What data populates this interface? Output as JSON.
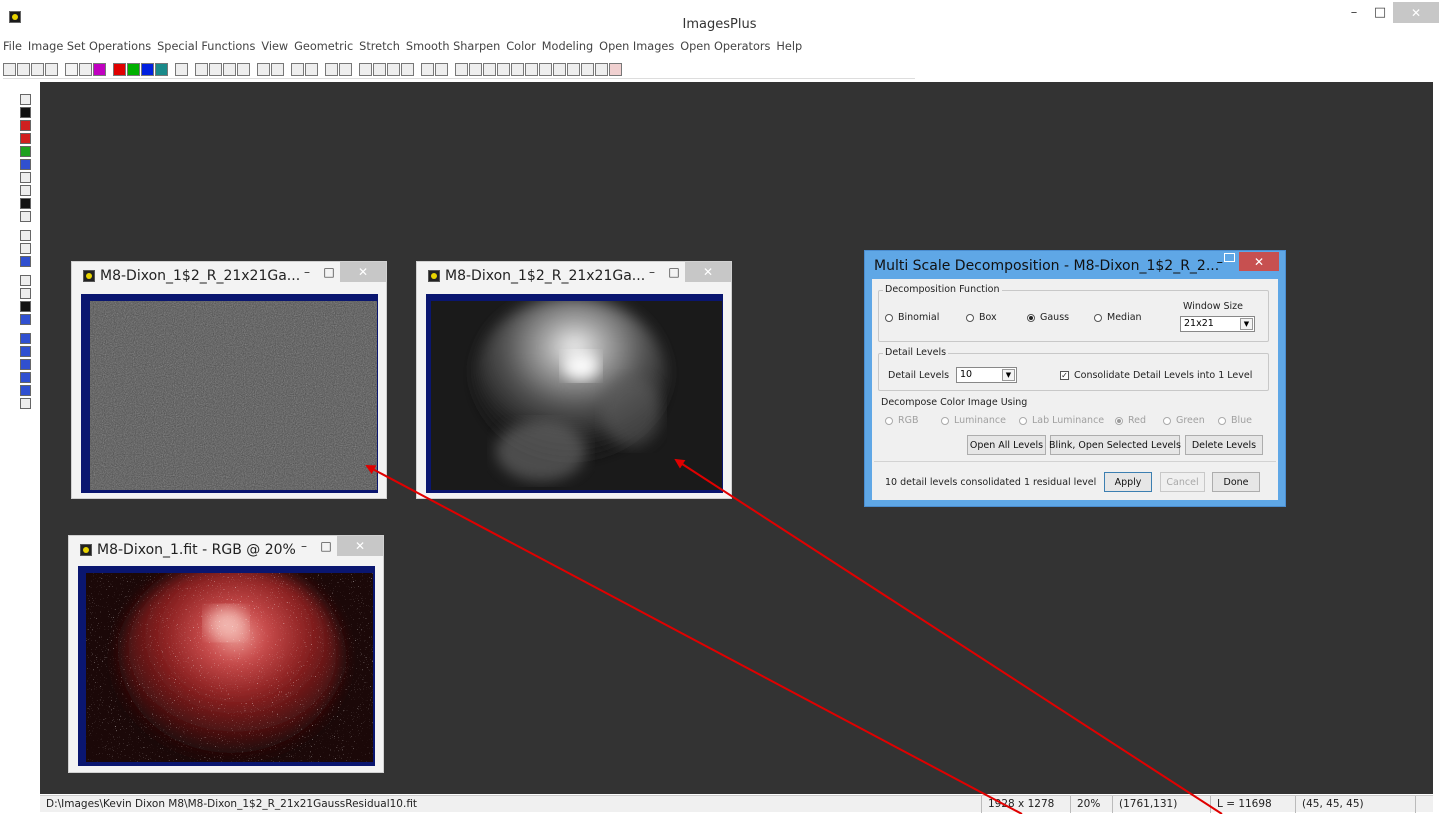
{
  "window": {
    "title": "ImagesPlus",
    "minimize": "–",
    "maximize": "□",
    "close": "✕"
  },
  "menu": [
    "File",
    "Image Set Operations",
    "Special Functions",
    "View",
    "Geometric",
    "Stretch",
    "Smooth Sharpen",
    "Color",
    "Modeling",
    "Open Images",
    "Open Operators",
    "Help"
  ],
  "toolbar_icons": [
    "new-icon",
    "open-icon",
    "save-icon",
    "cross-icon",
    "red-cross-icon",
    "calc-icon",
    "rgb-icon",
    "red-icon",
    "green-icon",
    "blue-icon",
    "teal-icon",
    "arrow-left-icon",
    "arrow-right-icon",
    "arrow-left-red-icon",
    "arrow-right-red-icon",
    "align-icon",
    "align2-icon",
    "dots-icon",
    "dots2-icon",
    "triangle-icon",
    "l-icon",
    "plus-icon",
    "crosshair-icon",
    "grid-icon",
    "grid2-icon",
    "pencil-icon",
    "square-icon",
    "zoom-in-icon",
    "zoom-icon",
    "zoom-fit-icon",
    "zoom-out-icon",
    "plus-box-icon",
    "minus-box-icon",
    "frame1-icon",
    "frame2-icon",
    "frame3-icon",
    "frame4-icon",
    "frame5-icon",
    "frame6-icon",
    "grid-red-icon"
  ],
  "image_windows": [
    {
      "title": "M8-Dixon_1$2_R_21x21Ga...",
      "kind": "residual"
    },
    {
      "title": "M8-Dixon_1$2_R_21x21Ga...",
      "kind": "gauss"
    },
    {
      "title": "M8-Dixon_1.fit - RGB @ 20%",
      "kind": "rgb"
    }
  ],
  "dialog": {
    "title": "Multi Scale Decomposition - M8-Dixon_1$2_R_2...",
    "decomposition": {
      "legend": "Decomposition Function",
      "options": [
        "Binomial",
        "Box",
        "Gauss",
        "Median"
      ],
      "selected": "Gauss",
      "window_size_label": "Window Size",
      "window_size": "21x21"
    },
    "detail": {
      "legend": "Detail Levels",
      "label": "Detail Levels",
      "value": "10",
      "consolidate_label": "Consolidate Detail Levels into 1 Level",
      "consolidate_checked": true
    },
    "color": {
      "legend": "Decompose Color Image Using",
      "options": [
        "RGB",
        "Luminance",
        "Lab Luminance",
        "Red",
        "Green",
        "Blue"
      ],
      "selected": "Red"
    },
    "buttons": {
      "open_all": "Open All Levels",
      "blink": "Blink, Open Selected Levels",
      "delete": "Delete Levels",
      "apply": "Apply",
      "cancel": "Cancel",
      "done": "Done"
    },
    "status": "10 detail levels consolidated  1 residual level"
  },
  "status": {
    "path": "D:\\Images\\Kevin Dixon M8\\M8-Dixon_1$2_R_21x21GaussResidual10.fit",
    "size": "1928 x 1278",
    "zoom": "20%",
    "coords": "(1761,131)",
    "luminance": "L = 11698",
    "rgb": "(45, 45, 45)"
  },
  "colors": {
    "workspace": "#333333",
    "frame": "#0a1670",
    "dialog_border": "#5fa7e6",
    "arrow": "#e00000"
  }
}
